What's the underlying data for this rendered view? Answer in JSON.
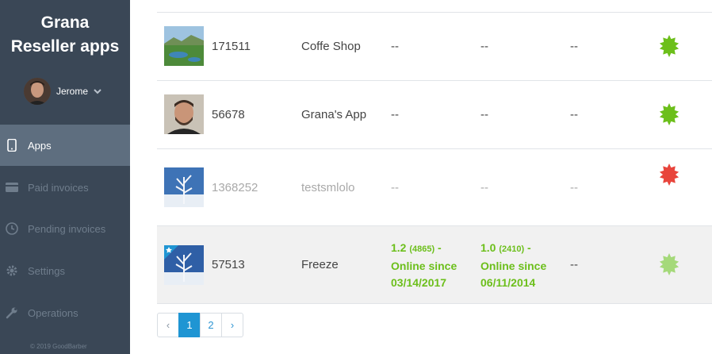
{
  "sidebar": {
    "brand_line1": "Grana",
    "brand_line2": "Reseller apps",
    "user_name": "Jerome",
    "nav": [
      {
        "label": "Apps"
      },
      {
        "label": "Paid invoices"
      },
      {
        "label": "Pending invoices"
      },
      {
        "label": "Settings"
      },
      {
        "label": "Operations"
      }
    ],
    "copyright": "© 2019 GoodBarber"
  },
  "apps": [
    {
      "id": "171511",
      "name": "Coffe Shop",
      "col1": "--",
      "col2": "--",
      "col3": "--",
      "status": "green"
    },
    {
      "id": "56678",
      "name": "Grana's App",
      "col1": "--",
      "col2": "--",
      "col3": "--",
      "status": "green"
    },
    {
      "id": "1368252",
      "name": "testsmlolo",
      "col1": "--",
      "col2": "--",
      "col3": "--",
      "status": "red"
    },
    {
      "id": "57513",
      "name": "Freeze",
      "ios": {
        "version": "1.2",
        "build": "(4865)",
        "suffix": " -",
        "online": "Online since",
        "date": "03/14/2017"
      },
      "android": {
        "version": "1.0",
        "build": "(2410)",
        "suffix": " -",
        "online": "Online since",
        "date": "06/11/2014"
      },
      "col3": "--",
      "status": "light-green"
    }
  ],
  "pagination": {
    "prev": "‹",
    "pages": [
      "1",
      "2"
    ],
    "next": "›",
    "current": "1"
  },
  "colors": {
    "sidebar": "#3a4756",
    "active_nav": "#5e6e7f",
    "green": "#6cbf1b",
    "red": "#e8453c",
    "light_green": "#a5d97a",
    "link": "#1f95d3"
  }
}
